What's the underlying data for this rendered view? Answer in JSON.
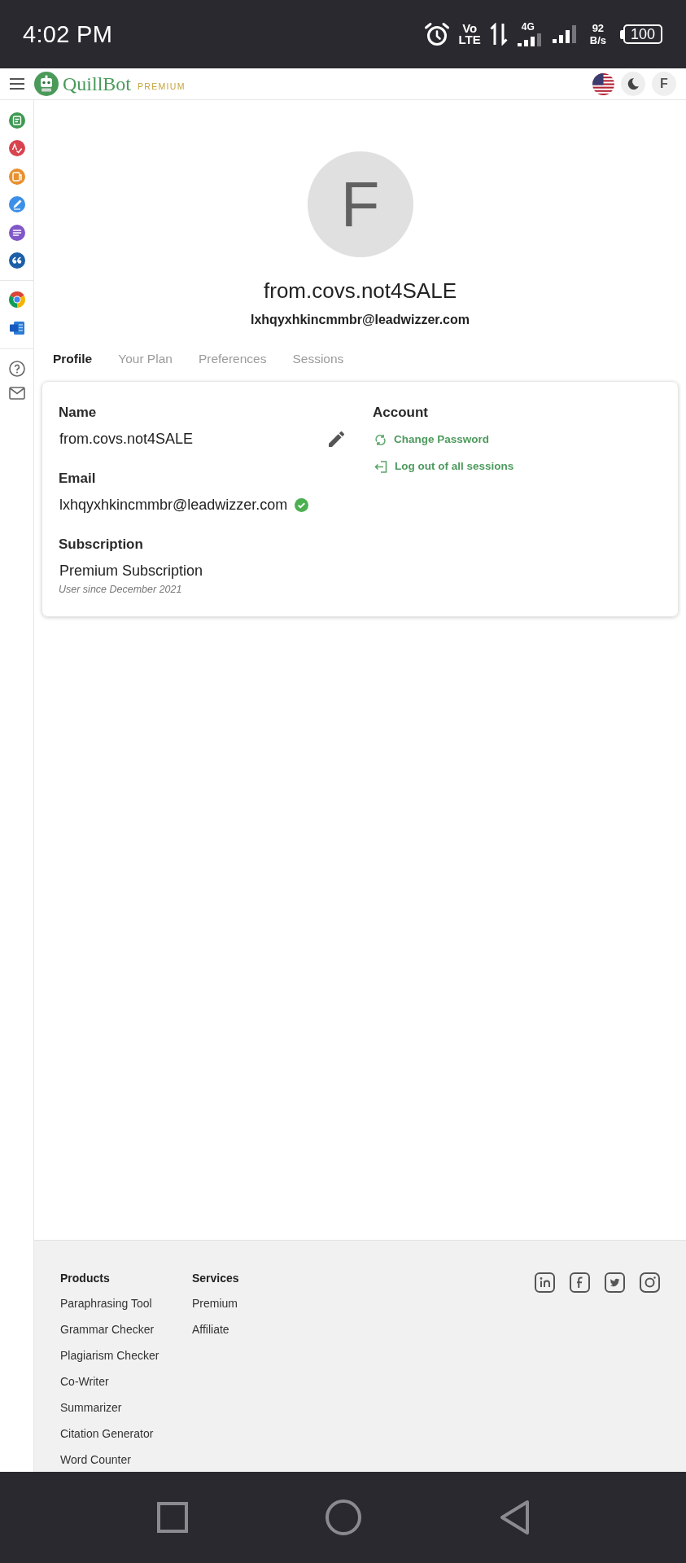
{
  "status_bar": {
    "time": "4:02 PM",
    "volte": [
      "Vo",
      "LTE"
    ],
    "network_type": "4G",
    "speed": [
      "92",
      "B/s"
    ],
    "battery": "100"
  },
  "header": {
    "brand": "QuillBot",
    "badge": "PREMIUM",
    "account_letter": "F"
  },
  "profile": {
    "avatar_letter": "F",
    "username": "from.covs.not4SALE",
    "email": "lxhqyxhkincmmbr@leadwizzer.com"
  },
  "tabs": [
    {
      "label": "Profile",
      "selected": true
    },
    {
      "label": "Your Plan",
      "selected": false
    },
    {
      "label": "Preferences",
      "selected": false
    },
    {
      "label": "Sessions",
      "selected": false
    }
  ],
  "details": {
    "fields": [
      {
        "label": "Name",
        "value": "from.covs.not4SALE",
        "editable": true,
        "verified": false
      },
      {
        "label": "Email",
        "value": "lxhqyxhkincmmbr@leadwizzer.com",
        "editable": false,
        "verified": true
      },
      {
        "label": "Subscription",
        "value": "Premium Subscription",
        "note": "User since December 2021",
        "editable": false,
        "verified": false
      }
    ],
    "account": {
      "title": "Account",
      "actions": [
        {
          "kind": "change_password",
          "label": "Change Password"
        },
        {
          "kind": "logout_all",
          "label": "Log out of all sessions"
        }
      ]
    }
  },
  "footer": {
    "columns": [
      {
        "title": "Products",
        "links": [
          "Paraphrasing Tool",
          "Grammar Checker",
          "Plagiarism Checker",
          "Co-Writer",
          "Summarizer",
          "Citation Generator",
          "Word Counter"
        ]
      },
      {
        "title": "Services",
        "links": [
          "Premium",
          "Affiliate"
        ]
      }
    ]
  }
}
